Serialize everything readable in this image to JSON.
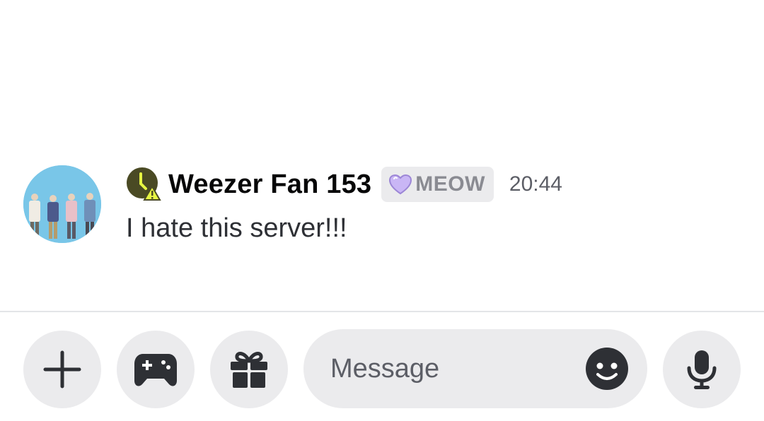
{
  "message": {
    "author": "Weezer Fan 153",
    "status_icon": "clock-warning-icon",
    "tag_icon": "purple-heart-icon",
    "tag": "MEOW",
    "timestamp": "20:44",
    "content": "I hate this server!!!"
  },
  "composer": {
    "placeholder": "Message",
    "buttons": [
      "plus-icon",
      "gamepad-icon",
      "gift-icon",
      "emoji-icon",
      "microphone-icon"
    ]
  },
  "colors": {
    "background": "#ffffff",
    "button_bg": "#ebebed",
    "tag_heart": "#c9b6f5",
    "status_icon_bg": "#4a4a24",
    "status_icon_accent": "#e6f542"
  }
}
